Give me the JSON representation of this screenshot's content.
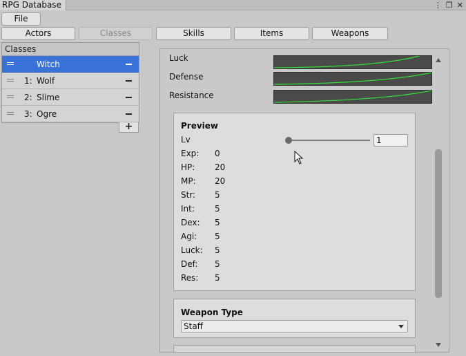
{
  "window": {
    "title": "RPG Database",
    "controls": [
      "⋮",
      "❐",
      "✕"
    ]
  },
  "menu": {
    "file_label": "File"
  },
  "tabs": [
    {
      "label": "Actors",
      "active": false
    },
    {
      "label": "Classes",
      "active": true
    },
    {
      "label": "Skills",
      "active": false
    },
    {
      "label": "Items",
      "active": false
    },
    {
      "label": "Weapons",
      "active": false
    }
  ],
  "class_list": {
    "header": "Classes",
    "items": [
      {
        "index": "",
        "name": "Witch",
        "selected": true
      },
      {
        "index": "1:",
        "name": "Wolf",
        "selected": false
      },
      {
        "index": "2:",
        "name": "Slime",
        "selected": false
      },
      {
        "index": "3:",
        "name": "Ogre",
        "selected": false
      }
    ],
    "add_label": "+"
  },
  "parameters": [
    {
      "label": "Luck"
    },
    {
      "label": "Defense"
    },
    {
      "label": "Resistance"
    }
  ],
  "preview": {
    "title": "Preview",
    "level_label": "Lv",
    "level_value": "1",
    "level_fraction": 0.0,
    "stats": [
      {
        "label": "Exp:",
        "value": "0"
      },
      {
        "label": "HP:",
        "value": "20"
      },
      {
        "label": "MP:",
        "value": "20"
      },
      {
        "label": "Str:",
        "value": "5"
      },
      {
        "label": "Int:",
        "value": "5"
      },
      {
        "label": "Dex:",
        "value": "5"
      },
      {
        "label": "Agi:",
        "value": "5"
      },
      {
        "label": "Luck:",
        "value": "5"
      },
      {
        "label": "Def:",
        "value": "5"
      },
      {
        "label": "Res:",
        "value": "5"
      }
    ]
  },
  "weapon_type": {
    "title": "Weapon Type",
    "selected": "Staff"
  },
  "colors": {
    "selection": "#3a73d8",
    "curve": "#35e03a",
    "curve_bg": "#4a4a4a"
  }
}
